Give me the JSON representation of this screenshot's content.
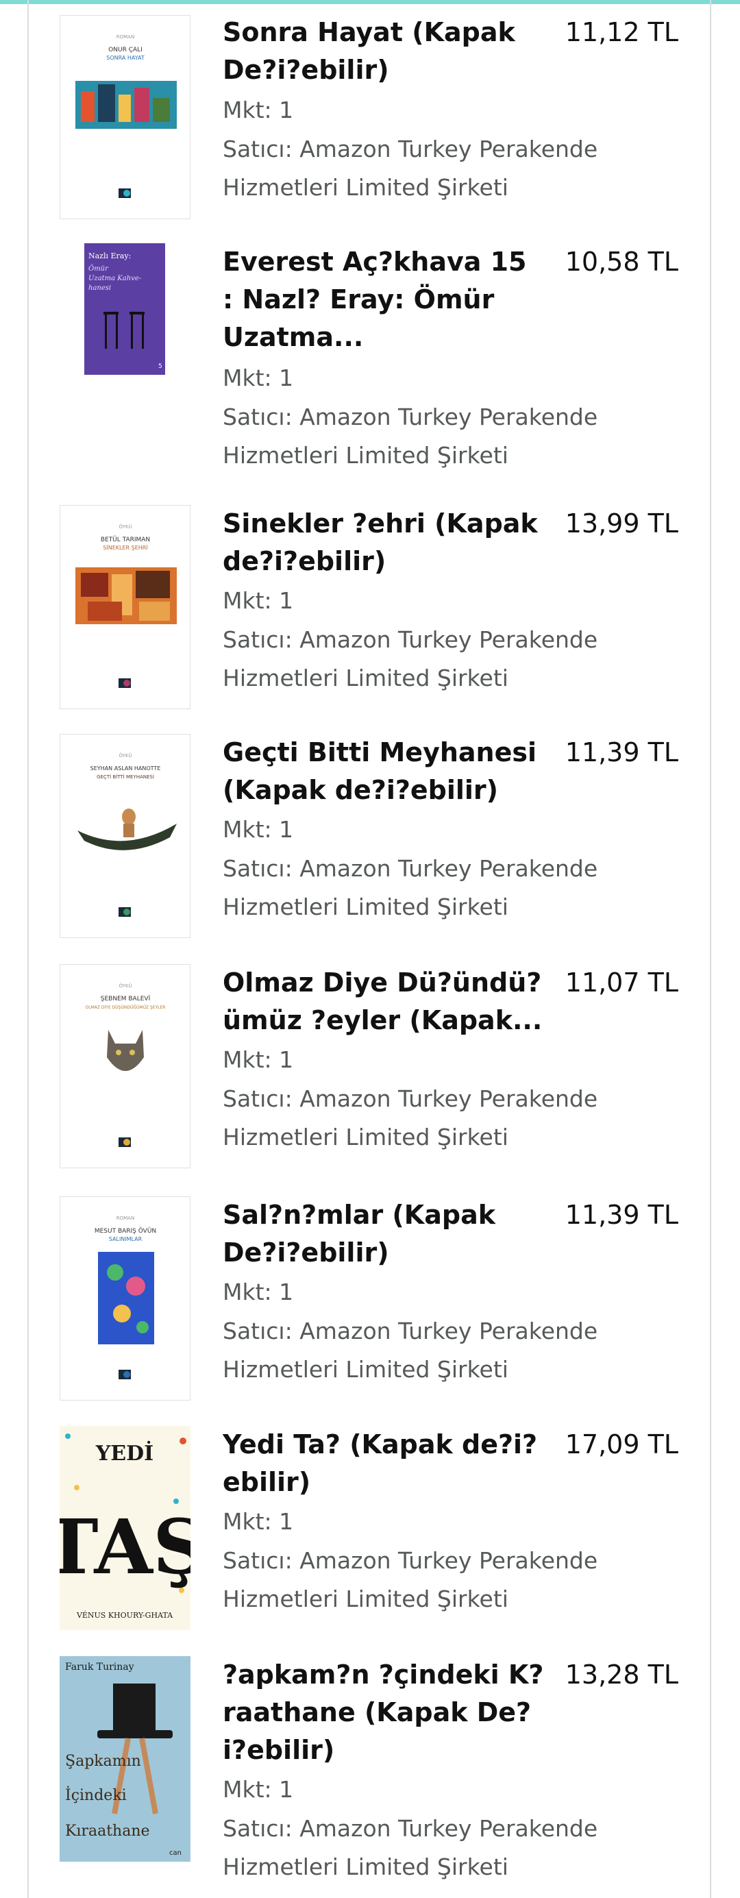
{
  "colors": {
    "accent_bar": "#7fdcd4",
    "title_text": "#111111",
    "meta_text": "#565959"
  },
  "items": [
    {
      "title": "Sonra Hayat (Kapak De?i?ebilir)",
      "price": "11,12 TL",
      "qty": "Mkt: 1",
      "seller": "Satıcı: Amazon Turkey Perakende Hizmetleri Limited Şirketi",
      "cover": {
        "genre": "ROMAN",
        "author": "ONUR ÇALI",
        "book": "SONRA HAYAT",
        "icon": "book-cover-sonra-hayat"
      }
    },
    {
      "title": "Everest Aç?khava 15 : Nazl? Eray: Ömür Uzatma...",
      "price": "10,58 TL",
      "qty": "Mkt: 1",
      "seller": "Satıcı: Amazon Turkey Perakende Hizmetleri Limited Şirketi",
      "cover": {
        "author": "Nazlı Eray:",
        "book": "Ömür Uzatma Kahvehanesi",
        "number": "5",
        "icon": "book-cover-everest"
      }
    },
    {
      "title": "Sinekler ?ehri (Kapak de?i?ebilir)",
      "price": "13,99 TL",
      "qty": "Mkt: 1",
      "seller": "Satıcı: Amazon Turkey Perakende Hizmetleri Limited Şirketi",
      "cover": {
        "genre": "ÖYKÜ",
        "author": "BETÜL TARIMAN",
        "book": "SİNEKLER ŞEHRİ",
        "icon": "book-cover-sinekler-sehri"
      }
    },
    {
      "title": "Geçti Bitti Meyhanesi (Kapak de?i?ebilir)",
      "price": "11,39 TL",
      "qty": "Mkt: 1",
      "seller": "Satıcı: Amazon Turkey Perakende Hizmetleri Limited Şirketi",
      "cover": {
        "genre": "ÖYKÜ",
        "author": "SEYHAN ASLAN HANOTTE",
        "book": "GEÇTİ BİTTİ MEYHANESİ",
        "icon": "book-cover-gecti-bitti"
      }
    },
    {
      "title": "Olmaz Diye Dü?ündü?ümüz ?eyler (Kapak...",
      "price": "11,07 TL",
      "qty": "Mkt: 1",
      "seller": "Satıcı: Amazon Turkey Perakende Hizmetleri Limited Şirketi",
      "cover": {
        "genre": "ÖYKÜ",
        "author": "ŞEBNEM BALEVİ",
        "book": "OLMAZ DİYE DÜŞÜNDÜĞÜMÜZ ŞEYLER",
        "icon": "book-cover-olmaz-diye"
      }
    },
    {
      "title": "Sal?n?mlar (Kapak De?i?ebilir)",
      "price": "11,39 TL",
      "qty": "Mkt: 1",
      "seller": "Satıcı: Amazon Turkey Perakende Hizmetleri Limited Şirketi",
      "cover": {
        "genre": "ROMAN",
        "author": "MESUT BARIŞ ÖVÜN",
        "book": "SALINIMLAR",
        "icon": "book-cover-salinimlar"
      }
    },
    {
      "title": "Yedi Ta? (Kapak de?i?ebilir)",
      "price": "17,09 TL",
      "qty": "Mkt: 1",
      "seller": "Satıcı: Amazon Turkey Perakende Hizmetleri Limited Şirketi",
      "cover": {
        "top": "YEDİ",
        "big": "TAŞ",
        "author": "VÉNUS KHOURY-GHATA",
        "icon": "book-cover-yedi-tas"
      }
    },
    {
      "title": "?apkam?n ?çindeki K?raathane (Kapak De?i?ebilir)",
      "price": "13,28 TL",
      "qty": "Mkt: 1",
      "seller": "Satıcı: Amazon Turkey Perakende Hizmetleri Limited Şirketi",
      "cover": {
        "author": "Faruk Turinay",
        "line1": "Şapkamın",
        "line2": "İçindeki",
        "line3": "Kıraathane",
        "publisher": "can",
        "icon": "book-cover-sapkamin"
      }
    }
  ]
}
